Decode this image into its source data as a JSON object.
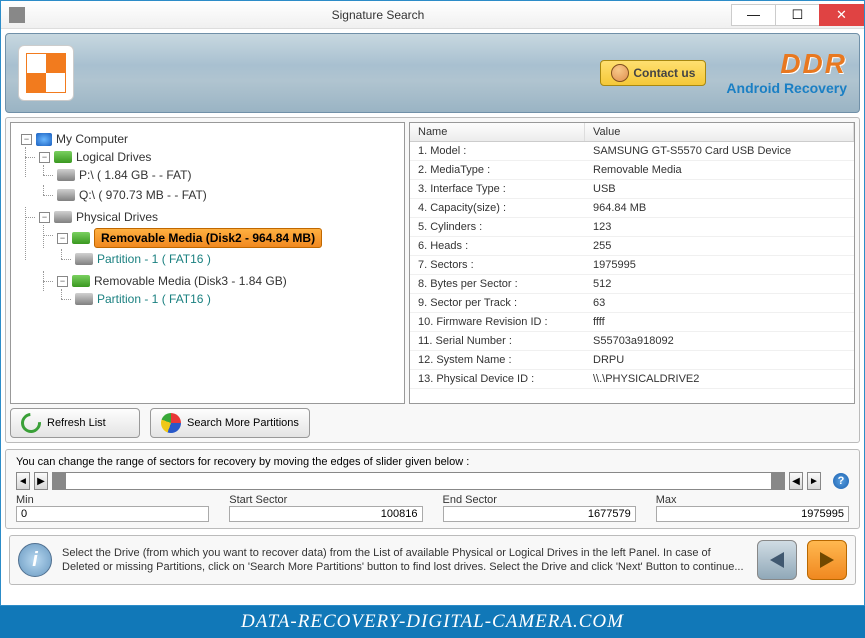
{
  "window": {
    "title": "Signature Search"
  },
  "header": {
    "contact_label": "Contact us",
    "brand": "DDR",
    "product": "Android Recovery"
  },
  "tree": {
    "root": "My Computer",
    "logical_label": "Logical Drives",
    "logical": [
      "P:\\ ( 1.84 GB -  - FAT)",
      "Q:\\ ( 970.73 MB -  - FAT)"
    ],
    "physical_label": "Physical Drives",
    "disk2_label": "Removable Media (Disk2 - 964.84 MB)",
    "disk2_part": "Partition - 1 ( FAT16 )",
    "disk3_label": "Removable Media (Disk3 - 1.84 GB)",
    "disk3_part": "Partition - 1 ( FAT16 )"
  },
  "props": {
    "col_name": "Name",
    "col_value": "Value",
    "rows": [
      {
        "name": "1. Model :",
        "value": "SAMSUNG GT-S5570 Card USB Device"
      },
      {
        "name": "2. MediaType :",
        "value": "Removable Media"
      },
      {
        "name": "3. Interface Type :",
        "value": "USB"
      },
      {
        "name": "4. Capacity(size) :",
        "value": "964.84 MB"
      },
      {
        "name": "5. Cylinders :",
        "value": "123"
      },
      {
        "name": "6. Heads :",
        "value": "255"
      },
      {
        "name": "7. Sectors :",
        "value": "1975995"
      },
      {
        "name": "8. Bytes per Sector :",
        "value": "512"
      },
      {
        "name": "9. Sector per Track :",
        "value": "63"
      },
      {
        "name": "10. Firmware Revision ID :",
        "value": "ffff"
      },
      {
        "name": "11. Serial Number :",
        "value": "S55703a918092"
      },
      {
        "name": "12. System Name :",
        "value": "DRPU"
      },
      {
        "name": "13. Physical Device ID :",
        "value": "\\\\.\\PHYSICALDRIVE2"
      }
    ]
  },
  "actions": {
    "refresh": "Refresh List",
    "search_more": "Search More Partitions"
  },
  "sector": {
    "hint": "You can change the range of sectors for recovery by moving the edges of slider given below :",
    "min_label": "Min",
    "min_value": "0",
    "start_label": "Start Sector",
    "start_value": "100816",
    "end_label": "End Sector",
    "end_value": "1677579",
    "max_label": "Max",
    "max_value": "1975995"
  },
  "footer": {
    "text": "Select the Drive (from which you want to recover data) from the List of available Physical or Logical Drives in the left Panel. In case of Deleted or missing Partitions, click on 'Search More Partitions' button to find lost drives. Select the Drive and click 'Next' Button to continue..."
  },
  "watermark": "DATA-RECOVERY-DIGITAL-CAMERA.COM"
}
